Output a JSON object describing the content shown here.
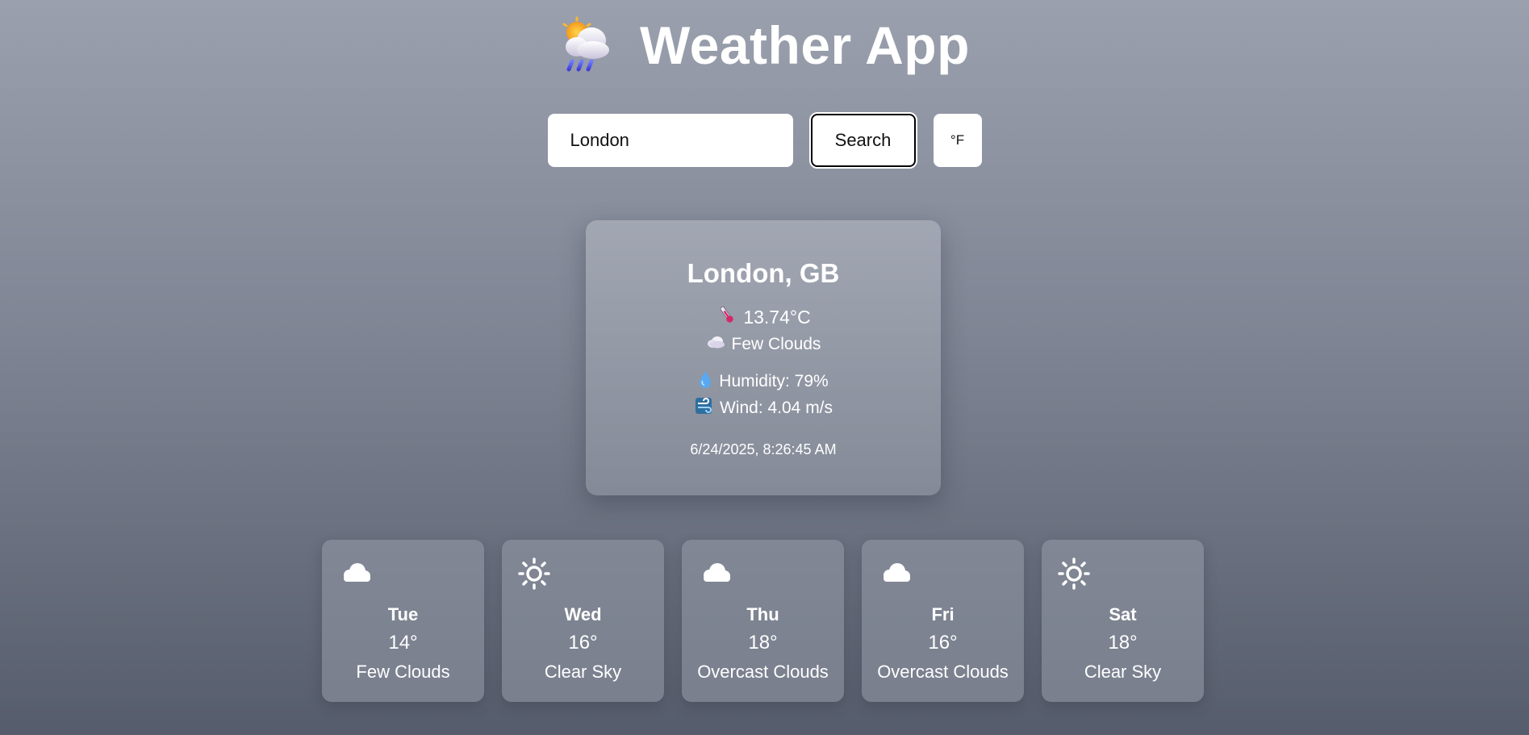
{
  "app": {
    "title": "Weather App",
    "logo_icon": "sun-behind-rain-cloud-icon"
  },
  "search": {
    "value": "London",
    "placeholder": "Enter city",
    "button_label": "Search",
    "unit_toggle_label": "°F"
  },
  "current": {
    "city": "London, GB",
    "temperature": "13.74°C",
    "temperature_icon": "thermometer-icon",
    "condition": "Few Clouds",
    "condition_icon": "cloud-icon",
    "humidity": "Humidity: 79%",
    "humidity_icon": "droplet-icon",
    "wind": "Wind: 4.04 m/s",
    "wind_icon": "wind-icon",
    "updated": "6/24/2025, 8:26:45 AM"
  },
  "forecast": [
    {
      "day": "Tue",
      "temp": "14°",
      "desc": "Few Clouds",
      "icon": "cloud-icon"
    },
    {
      "day": "Wed",
      "temp": "16°",
      "desc": "Clear Sky",
      "icon": "sun-icon"
    },
    {
      "day": "Thu",
      "temp": "18°",
      "desc": "Overcast Clouds",
      "icon": "cloud-icon"
    },
    {
      "day": "Fri",
      "temp": "16°",
      "desc": "Overcast Clouds",
      "icon": "cloud-icon"
    },
    {
      "day": "Sat",
      "temp": "18°",
      "desc": "Clear Sky",
      "icon": "sun-icon"
    }
  ],
  "colors": {
    "background_top": "#9aa0ad",
    "background_bottom": "#555c6b",
    "text": "#ffffff"
  }
}
